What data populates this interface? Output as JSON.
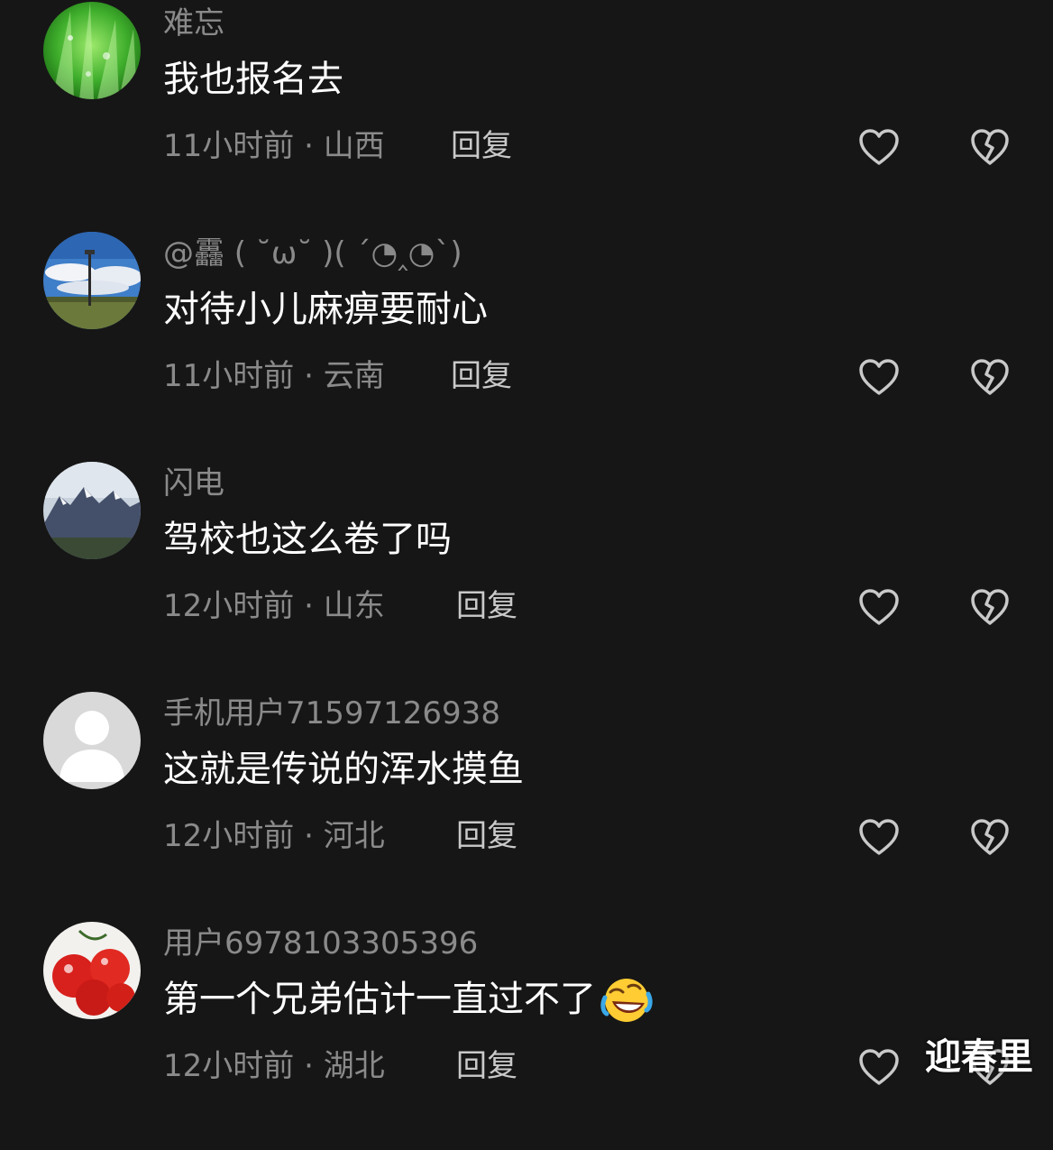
{
  "comments": [
    {
      "username": "难忘",
      "text": "我也报名去",
      "time": "11小时前",
      "location": "山西",
      "reply_label": "回复",
      "avatar": "green-grass"
    },
    {
      "username": "@靐 ( ˘ω˘ )( ´◔‸◔`)",
      "text": "对待小儿麻痹要耐心",
      "time": "11小时前",
      "location": "云南",
      "reply_label": "回复",
      "avatar": "sky-lamp-post"
    },
    {
      "username": "闪电",
      "text": "驾校也这么卷了吗",
      "time": "12小时前",
      "location": "山东",
      "reply_label": "回复",
      "avatar": "snowy-mountain"
    },
    {
      "username": "手机用户71597126938",
      "text": "这就是传说的浑水摸鱼",
      "time": "12小时前",
      "location": "河北",
      "reply_label": "回复",
      "avatar": "default-user"
    },
    {
      "username": "用户6978103305396",
      "text": "第一个兄弟估计一直过不了",
      "emoji": "rolling-on-floor-laughing",
      "time": "12小时前",
      "location": "湖北",
      "reply_label": "回复",
      "avatar": "red-cherries"
    }
  ],
  "icons": {
    "like": "heart-outline-icon",
    "dislike": "broken-heart-icon"
  },
  "colors": {
    "background": "#161616",
    "meta_text": "#8a8a8a",
    "reply_text": "#c9c9c9"
  },
  "watermark": "迎春里"
}
